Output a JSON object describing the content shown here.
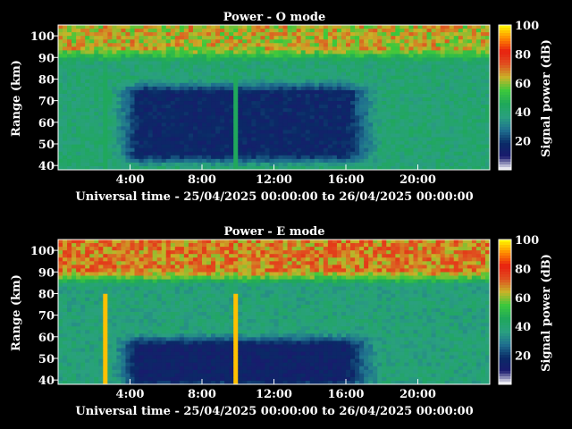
{
  "chart_data": [
    {
      "type": "heatmap",
      "title": "Power - O mode",
      "xlabel": "Universal time - 25/04/2025 00:00:00 to 26/04/2025 00:00:00",
      "ylabel": "Range (km)",
      "xlim_hours": [
        0,
        24
      ],
      "ylim_km": [
        38,
        105
      ],
      "x_ticks": [
        "4:00",
        "8:00",
        "12:00",
        "16:00",
        "20:00"
      ],
      "x_tick_hours": [
        4,
        8,
        12,
        16,
        20
      ],
      "y_ticks": [
        40,
        50,
        60,
        70,
        80,
        90,
        100
      ],
      "colorbar": {
        "label": "Signal power (dB)",
        "range": [
          0,
          100
        ],
        "ticks": [
          20,
          40,
          60,
          80,
          100
        ]
      },
      "features": {
        "baseline_power_db": 40,
        "depletion_band_km": [
          45,
          80
        ],
        "depletion_time_hours": [
          3,
          18
        ],
        "depletion_min_db": 12,
        "upper_layer_above_km": 88,
        "upper_layer_power_db": 63,
        "bright_spikes_hours": [
          2.6,
          9.9
        ],
        "spike_power_db": 45
      }
    },
    {
      "type": "heatmap",
      "title": "Power - E mode",
      "xlabel": "Universal time - 25/04/2025 00:00:00 to 26/04/2025 00:00:00",
      "ylabel": "Range (km)",
      "xlim_hours": [
        0,
        24
      ],
      "ylim_km": [
        38,
        105
      ],
      "x_ticks": [
        "4:00",
        "8:00",
        "12:00",
        "16:00",
        "20:00"
      ],
      "x_tick_hours": [
        4,
        8,
        12,
        16,
        20
      ],
      "y_ticks": [
        40,
        50,
        60,
        70,
        80,
        90,
        100
      ],
      "colorbar": {
        "label": "Signal power (dB)",
        "range": [
          0,
          100
        ],
        "ticks": [
          20,
          40,
          60,
          80,
          100
        ]
      },
      "features": {
        "baseline_power_db": 38,
        "depletion_band_km": [
          40,
          62
        ],
        "depletion_time_hours": [
          3,
          18
        ],
        "depletion_min_db": 10,
        "upper_layer_above_km": 84,
        "upper_layer_power_db": 68,
        "bright_spikes_hours": [
          2.6,
          9.9
        ],
        "spike_power_db": 95
      }
    }
  ],
  "colors": {
    "background": "#000000",
    "axis": "#ffffff",
    "colormap": [
      "#ffffff",
      "#1a1a6e",
      "#0a2a66",
      "#1f6f8f",
      "#2aa080",
      "#1fa85a",
      "#3cc83c",
      "#c8b428",
      "#e05020",
      "#e82010",
      "#ff8c00",
      "#ffff00"
    ]
  }
}
